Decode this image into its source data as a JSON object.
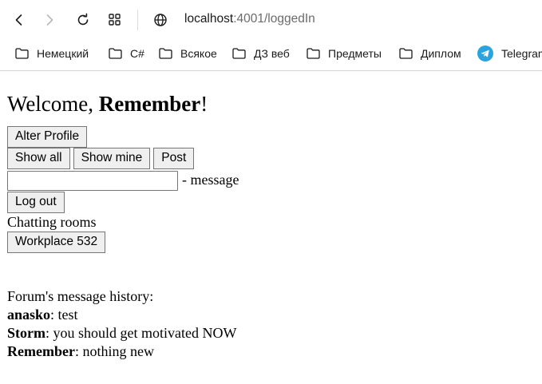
{
  "browser": {
    "url_host": "localhost",
    "url_path": ":4001/loggedIn",
    "bookmarks": [
      {
        "label": "Немецкий",
        "icon": "folder-icon"
      },
      {
        "label": "C#",
        "icon": "folder-icon"
      },
      {
        "label": "Всякое",
        "icon": "folder-icon"
      },
      {
        "label": "ДЗ веб",
        "icon": "folder-icon"
      },
      {
        "label": "Предметы",
        "icon": "folder-icon"
      },
      {
        "label": "Диплом",
        "icon": "folder-icon"
      },
      {
        "label": "Telegram",
        "icon": "telegram-icon"
      }
    ],
    "icons": {
      "back": "back-arrow-icon",
      "forward": "forward-arrow-icon",
      "reload": "reload-icon",
      "apps": "apps-grid-icon",
      "site_info": "globe-icon"
    },
    "accent_color": "#2aa3e0"
  },
  "page": {
    "welcome_prefix": "Welcome, ",
    "username": "Remember",
    "welcome_suffix": "!",
    "alter_profile_label": "Alter Profile",
    "show_all_label": "Show all",
    "show_mine_label": "Show mine",
    "post_label": "Post",
    "message_input_value": "",
    "message_label": "- message",
    "logout_label": "Log out",
    "rooms_title": "Chatting rooms",
    "rooms": [
      "Workplace 532"
    ],
    "history_title": "Forum's message history:",
    "messages": [
      {
        "author": "anasko",
        "text": ": test"
      },
      {
        "author": "Storm",
        "text": ": you should get motivated NOW"
      },
      {
        "author": "Remember",
        "text": ": nothing new"
      }
    ]
  }
}
